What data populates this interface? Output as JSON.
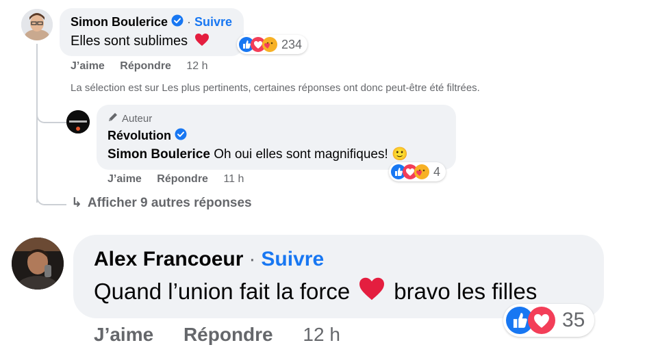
{
  "comment1": {
    "author": "Simon Boulerice",
    "separator": "·",
    "follow_label": "Suivre",
    "text": "Elles sont sublimes",
    "reaction_count": "234",
    "like_label": "J’aime",
    "reply_label": "Répondre",
    "time": "12 h"
  },
  "filter_notice": "La sélection est sur Les plus pertinents, certaines réponses ont donc peut-être été filtrées.",
  "reply1": {
    "badge_label": "Auteur",
    "author": "Révolution",
    "mention": "Simon Boulerice",
    "text": "Oh oui elles sont magnifiques! 🙂",
    "reaction_count": "4",
    "like_label": "J’aime",
    "reply_label": "Répondre",
    "time": "11 h",
    "avatar_text": "Révolution"
  },
  "more_replies": {
    "arrow": "↳",
    "label": "Afficher 9 autres réponses"
  },
  "comment2": {
    "author": "Alex Francoeur",
    "separator": "·",
    "follow_label": "Suivre",
    "text_before": "Quand l’union fait la force",
    "text_after": "bravo les filles",
    "reaction_count": "35",
    "like_label": "J’aime",
    "reply_label": "Répondre",
    "time": "12 h"
  },
  "colors": {
    "accent": "#1877f2",
    "like_blue": "#1877f2",
    "love_red": "#f33e58",
    "care_yellow": "#f7b125",
    "bubble": "#f0f2f5",
    "muted": "#65676b"
  },
  "icons": [
    "verified-badge-icon",
    "heart-emoji-icon",
    "like-reaction-icon",
    "love-reaction-icon",
    "care-reaction-icon",
    "pen-icon",
    "reply-arrow-icon"
  ]
}
